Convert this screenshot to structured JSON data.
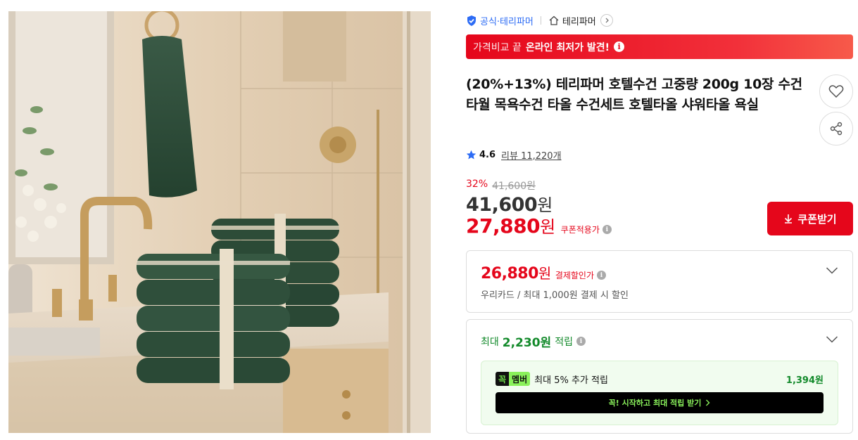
{
  "brand": {
    "official_label": "공식·테리파머",
    "store_name": "테리파머"
  },
  "promo_banner": {
    "prefix": "가격비교 끝",
    "highlight": "온라인 최저가 발견!"
  },
  "product": {
    "title": "(20%+13%) 테리파머 호텔수건 고중량 200g 10장 수건 타월 목욕수건 타올 수건세트 호텔타올 샤워타올 욕실",
    "rating": "4.6",
    "reviews_label": "리뷰 11,220개"
  },
  "pricing": {
    "discount_rate": "32%",
    "original_price": "41,600원",
    "price_amount": "41,600",
    "price_unit": "원",
    "coupon_price_amount": "27,880",
    "coupon_price_unit": "원",
    "coupon_note": "쿠폰적용가",
    "coupon_button": "쿠폰받기"
  },
  "payment_discount": {
    "amount": "26,880",
    "unit": "원",
    "label": "결제할인가",
    "description": "우리카드 / 최대 1,000원 결제 시 할인"
  },
  "points": {
    "prefix": "최대",
    "amount": "2,230원",
    "suffix": "적립",
    "member_badge_left": "꼭",
    "member_badge_right": "멤버",
    "member_text": "최대 5% 추가 적립",
    "member_bonus": "1,394원",
    "member_cta": "꼭! 시작하고 최대 적립 받기"
  },
  "colors": {
    "accent_red": "#e5061b",
    "green": "#138a2b",
    "official_blue": "#2d6cf5",
    "member_green": "#8af15b"
  },
  "icons": {
    "official": "shield-check-icon",
    "store": "home-icon",
    "wishlist": "heart-icon",
    "share": "share-icon",
    "rating": "star-icon",
    "coupon": "download-icon"
  }
}
